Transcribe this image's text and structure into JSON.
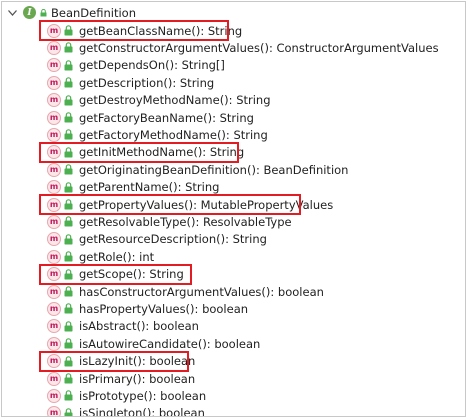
{
  "tree": {
    "root_label": "BeanDefinition",
    "methods": [
      {
        "label": "getBeanClassName(): String"
      },
      {
        "label": "getConstructorArgumentValues(): ConstructorArgumentValues"
      },
      {
        "label": "getDependsOn(): String[]"
      },
      {
        "label": "getDescription(): String"
      },
      {
        "label": "getDestroyMethodName(): String"
      },
      {
        "label": "getFactoryBeanName(): String"
      },
      {
        "label": "getFactoryMethodName(): String"
      },
      {
        "label": "getInitMethodName(): String"
      },
      {
        "label": "getOriginatingBeanDefinition(): BeanDefinition"
      },
      {
        "label": "getParentName(): String"
      },
      {
        "label": "getPropertyValues(): MutablePropertyValues"
      },
      {
        "label": "getResolvableType(): ResolvableType"
      },
      {
        "label": "getResourceDescription(): String"
      },
      {
        "label": "getRole(): int"
      },
      {
        "label": "getScope(): String"
      },
      {
        "label": "hasConstructorArgumentValues(): boolean"
      },
      {
        "label": "hasPropertyValues(): boolean"
      },
      {
        "label": "isAbstract(): boolean"
      },
      {
        "label": "isAutowireCandidate(): boolean"
      },
      {
        "label": "isLazyInit(): boolean"
      },
      {
        "label": "isPrimary(): boolean"
      },
      {
        "label": "isPrototype(): boolean"
      },
      {
        "label": "isSingleton(): boolean"
      }
    ]
  },
  "icons": {
    "expand": "chevron-down-icon",
    "interface": "interface-icon",
    "method": "method-icon",
    "visibility": "lock-icon"
  },
  "colors": {
    "highlight": "#e31c23",
    "interface_badge": "#6aa84f",
    "method_badge": "#c2185b",
    "lock": "#4caf50"
  }
}
